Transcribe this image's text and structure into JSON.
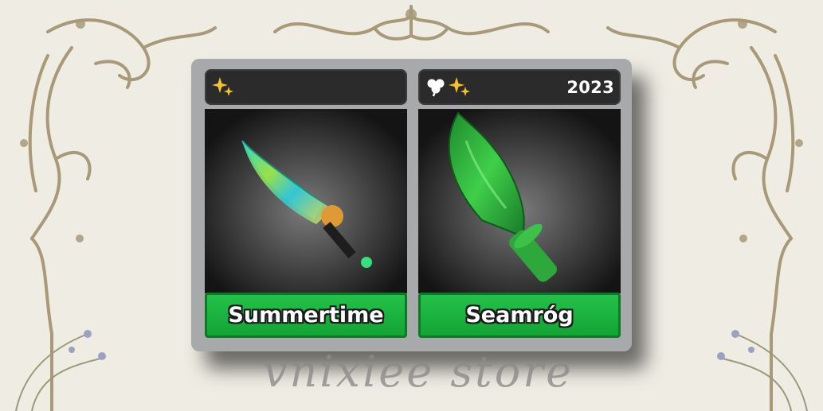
{
  "colors": {
    "page_background": "#efece3",
    "ornament": "#a89a78",
    "panel": "#a7a9ab",
    "name_button": "#1cb640",
    "header_bg": "#2b2b2b"
  },
  "items": [
    {
      "name": "Summertime",
      "icons": [
        "sparkle-icon"
      ],
      "year": ""
    },
    {
      "name": "Seamróg",
      "icons": [
        "clover-icon",
        "sparkle-icon"
      ],
      "year": "2023"
    }
  ],
  "watermark": "vnixiee store"
}
